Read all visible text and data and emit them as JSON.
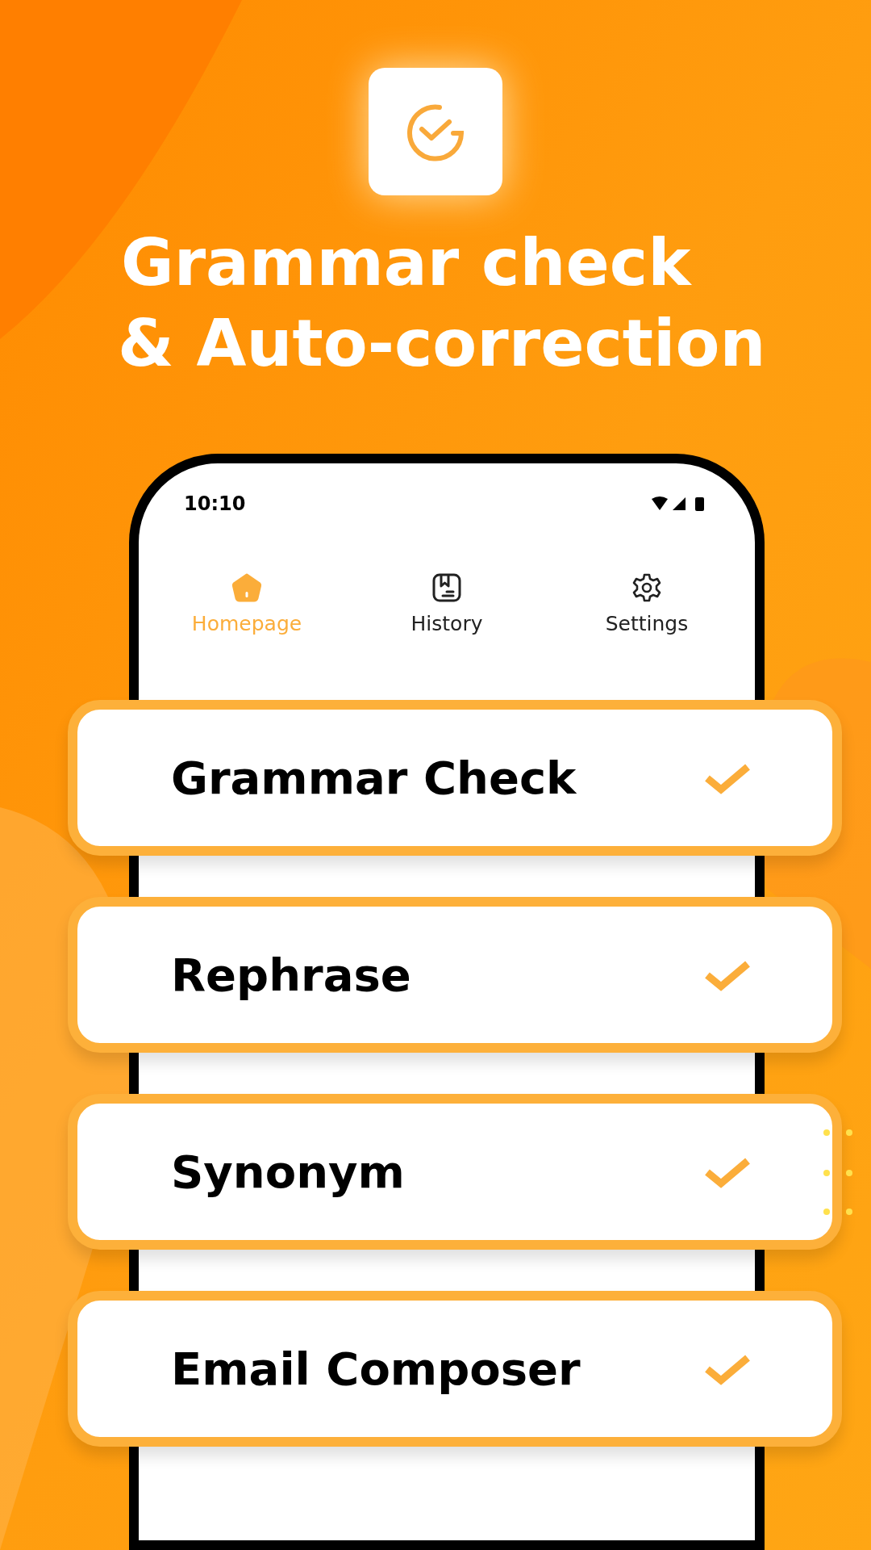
{
  "headline": {
    "line_1": "Grammar check",
    "line_2": "& Auto-correction"
  },
  "status_bar": {
    "time": "10:10"
  },
  "tabs": [
    {
      "label": "Homepage",
      "selected": true
    },
    {
      "label": "History",
      "selected": false
    },
    {
      "label": "Settings",
      "selected": false
    }
  ],
  "features": [
    {
      "label": "Grammar Check"
    },
    {
      "label": "Rephrase"
    },
    {
      "label": "Synonym"
    },
    {
      "label": "Email Composer"
    }
  ]
}
